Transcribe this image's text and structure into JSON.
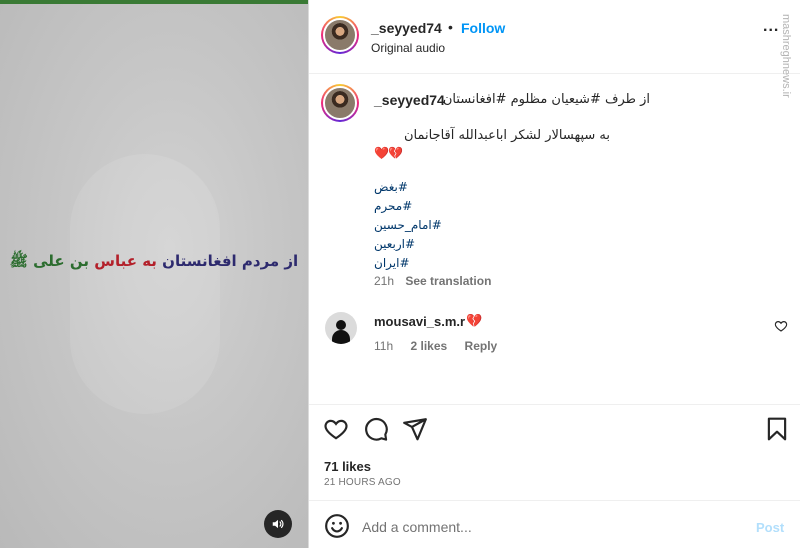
{
  "post": {
    "video_caption": {
      "part1": "از مردم افغانستان",
      "part2": "به عباس",
      "part3": "بن علی",
      "emblem": "ﷺ"
    },
    "sound_icon": "speaker-icon"
  },
  "header": {
    "username": "_seyyed74",
    "separator": "•",
    "follow_label": "Follow",
    "audio_label": "Original audio",
    "more_label": "..."
  },
  "watermark": "mashreghnews.ir",
  "caption": {
    "username": "_seyyed74",
    "line1": "از طرف #شیعیان مظلوم #افغانستان",
    "line2": "به سپهسالار لشکر اباعبدالله آقاجانمان",
    "emojis": "❤️💔",
    "hashtags": [
      "#بغض",
      "#محرم",
      "#امام_حسین",
      "#اربعین",
      "#ایران"
    ],
    "time": "21h",
    "translation_label": "See translation"
  },
  "comment": {
    "username": "mousavi_s.m.r",
    "text": "💔",
    "time": "11h",
    "likes": "2 likes",
    "reply_label": "Reply"
  },
  "actions": {
    "likes": "71 likes",
    "time_ago": "21 HOURS AGO"
  },
  "composer": {
    "placeholder": "Add a comment...",
    "post_label": "Post"
  }
}
